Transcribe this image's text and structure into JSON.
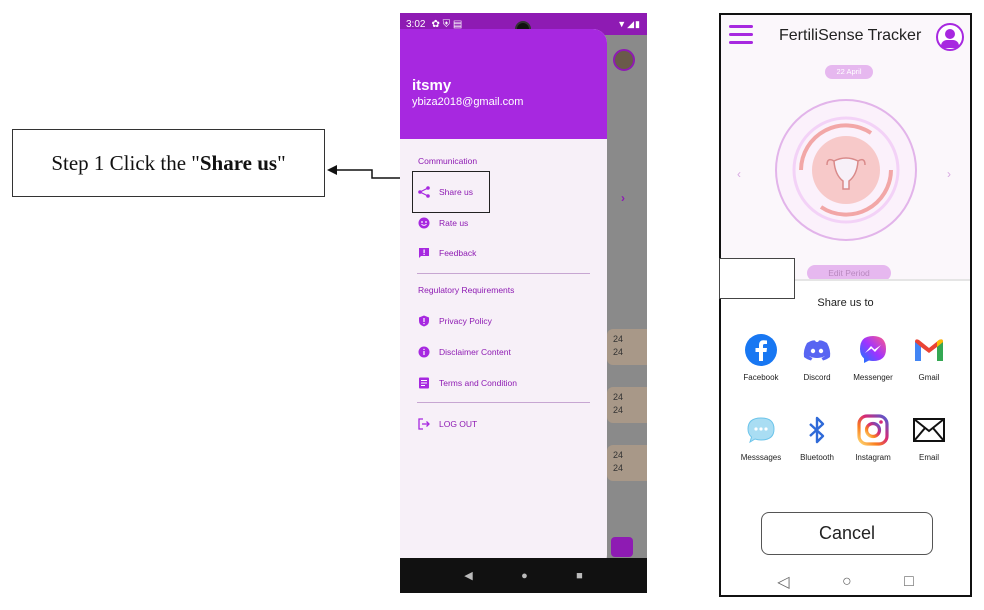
{
  "callout": {
    "prefix": "Step 1 Click the \"",
    "bold": "Share us",
    "suffix": "\""
  },
  "phone1": {
    "status_time": "3:02",
    "status_icons": "✿ ⛨ ▤",
    "status_right": "▼◢▮",
    "user_name": "itsmy",
    "user_email": "ybiza2018@gmail.com",
    "section_communication": "Communication",
    "item_share": "Share us",
    "item_rate": "Rate us",
    "item_feedback": "Feedback",
    "section_regulatory": "Regulatory Requirements",
    "item_privacy": "Privacy Policy",
    "item_disclaimer": "Disclaimer Content",
    "item_terms": "Terms and Condition",
    "item_logout": "LOG OUT",
    "bg_card_1": "24\n24",
    "bg_card_2": "24\n24",
    "bg_card_3": "24\n24",
    "nav_back": "◀",
    "nav_home": "●",
    "nav_recent": "■",
    "accent": "#a728e0"
  },
  "phone2": {
    "title": "FertiliSense Tracker",
    "date_label": "22 April",
    "edit_label": "Edit Period",
    "arrow_left": "‹",
    "arrow_right": "›",
    "sheet_title": "Share us to",
    "options": [
      {
        "label": "Facebook",
        "icon": "facebook-icon"
      },
      {
        "label": "Discord",
        "icon": "discord-icon"
      },
      {
        "label": "Messenger",
        "icon": "messenger-icon"
      },
      {
        "label": "Gmail",
        "icon": "gmail-icon"
      },
      {
        "label": "Messsages",
        "icon": "messages-icon"
      },
      {
        "label": "Bluetooth",
        "icon": "bluetooth-icon"
      },
      {
        "label": "Instagram",
        "icon": "instagram-icon"
      },
      {
        "label": "Email",
        "icon": "email-icon"
      }
    ],
    "cancel_label": "Cancel",
    "nav_back": "◁",
    "nav_home": "○",
    "nav_recent": "□"
  }
}
